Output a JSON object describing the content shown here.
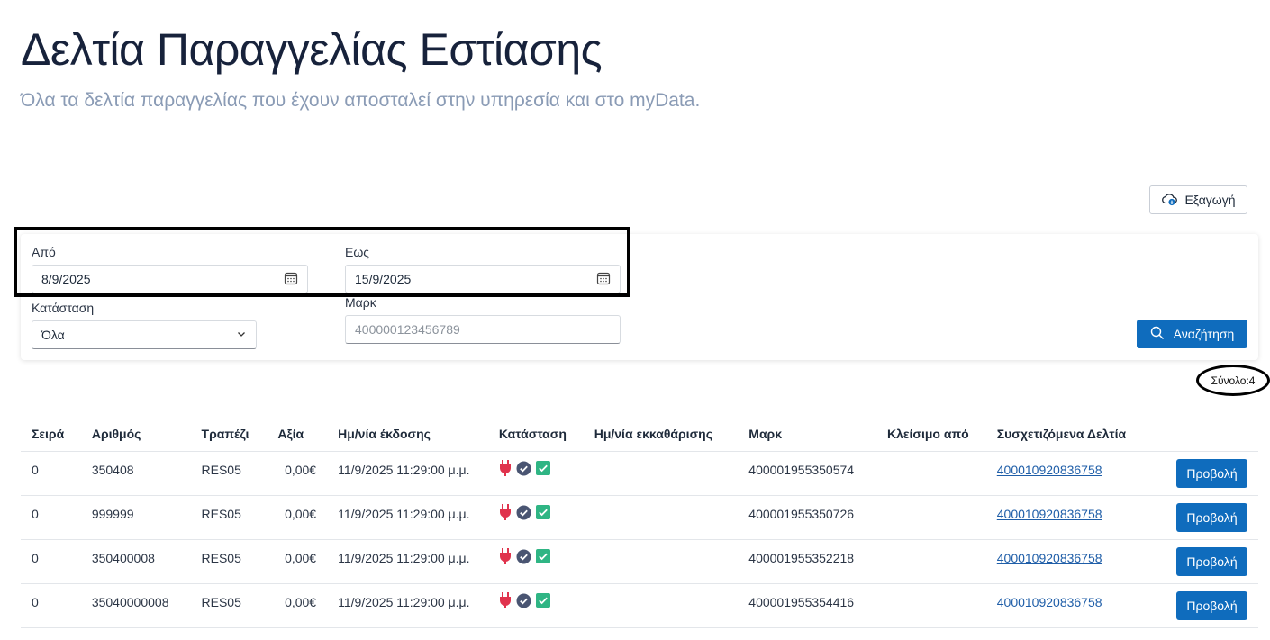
{
  "header": {
    "title": "Δελτία Παραγγελίας Εστίασης",
    "subtitle": "Όλα τα δελτία παραγγελίας που έχουν αποσταλεί στην υπηρεσία και στο myData."
  },
  "toolbar": {
    "export_label": "Εξαγωγή",
    "export_icon": "cloud-download-icon"
  },
  "filters": {
    "from_label": "Από",
    "from_value": "8/9/2025",
    "to_label": "Εως",
    "to_value": "15/9/2025",
    "status_label": "Κατάσταση",
    "status_value": "Όλα",
    "mark_label": "Μαρκ",
    "mark_placeholder": "400000123456789",
    "search_label": "Αναζήτηση",
    "calendar_icon": "calendar-icon",
    "search_icon": "search-icon"
  },
  "summary": {
    "total_label": "Σύνολο:4"
  },
  "table": {
    "columns": [
      "Σειρά",
      "Αριθμός",
      "Τραπέζι",
      "Αξία",
      "Ημ/νία έκδοσης",
      "Κατάσταση",
      "Ημ/νία εκκαθάρισης",
      "Μαρκ",
      "Κλείσιμο από",
      "Συσχετιζόμενα Δελτία"
    ],
    "view_label": "Προβολή",
    "status_icons": [
      "plug-icon",
      "check-circle-icon",
      "check-square-icon"
    ],
    "status_colors": {
      "plug": "#e0334d",
      "circle": "#4a5572",
      "square": "#2fb584"
    },
    "rows": [
      {
        "series": "0",
        "number": "350408",
        "table": "RES05",
        "value": "0,00€",
        "issue_date": "11/9/2025 11:29:00 μ.μ.",
        "clear_date": "",
        "mark": "400001955350574",
        "closed_by": "",
        "related": "400010920836758"
      },
      {
        "series": "0",
        "number": "999999",
        "table": "RES05",
        "value": "0,00€",
        "issue_date": "11/9/2025 11:29:00 μ.μ.",
        "clear_date": "",
        "mark": "400001955350726",
        "closed_by": "",
        "related": "400010920836758"
      },
      {
        "series": "0",
        "number": "350400008",
        "table": "RES05",
        "value": "0,00€",
        "issue_date": "11/9/2025 11:29:00 μ.μ.",
        "clear_date": "",
        "mark": "400001955352218",
        "closed_by": "",
        "related": "400010920836758"
      },
      {
        "series": "0",
        "number": "35040000008",
        "table": "RES05",
        "value": "0,00€",
        "issue_date": "11/9/2025 11:29:00 μ.μ.",
        "clear_date": "",
        "mark": "400001955354416",
        "closed_by": "",
        "related": "400010920836758"
      }
    ]
  },
  "colors": {
    "primary": "#0f6cbd",
    "title": "#17223b",
    "subtitle": "#8a9bb5",
    "link": "#1f5ea8"
  }
}
